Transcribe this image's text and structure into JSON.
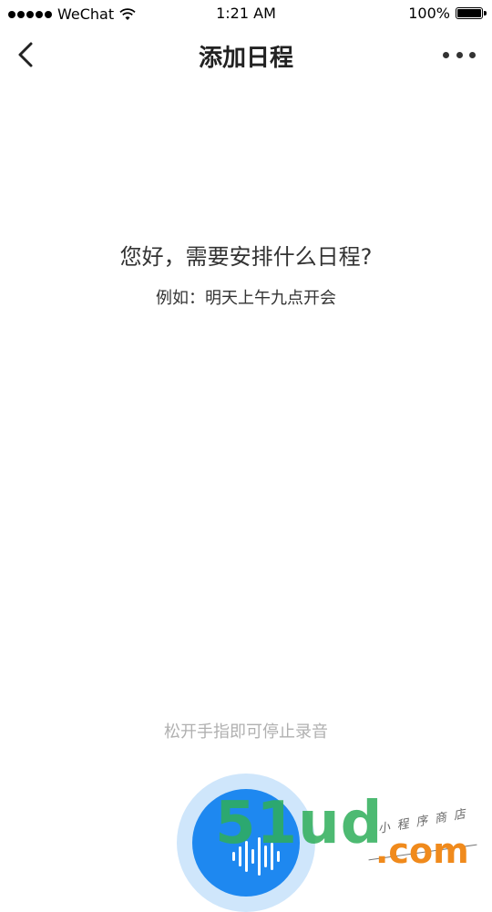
{
  "status_bar": {
    "carrier": "WeChat",
    "time": "1:21 AM",
    "battery_text": "100%",
    "battery_level": 1.0
  },
  "nav": {
    "title": "添加日程",
    "back_icon": "chevron-left-icon",
    "more_icon": "more-dots-icon"
  },
  "content": {
    "prompt_title": "您好，需要安排什么日程?",
    "prompt_example": "例如：明天上午九点开会",
    "release_hint": "松开手指即可停止录音"
  },
  "mic": {
    "icon": "voice-wave-icon",
    "accent_color": "#1e88f0",
    "halo_color": "#cfe6fb"
  },
  "watermark": {
    "logo": "51ud",
    "tagline": "小程序商店",
    "domain": ".com"
  }
}
